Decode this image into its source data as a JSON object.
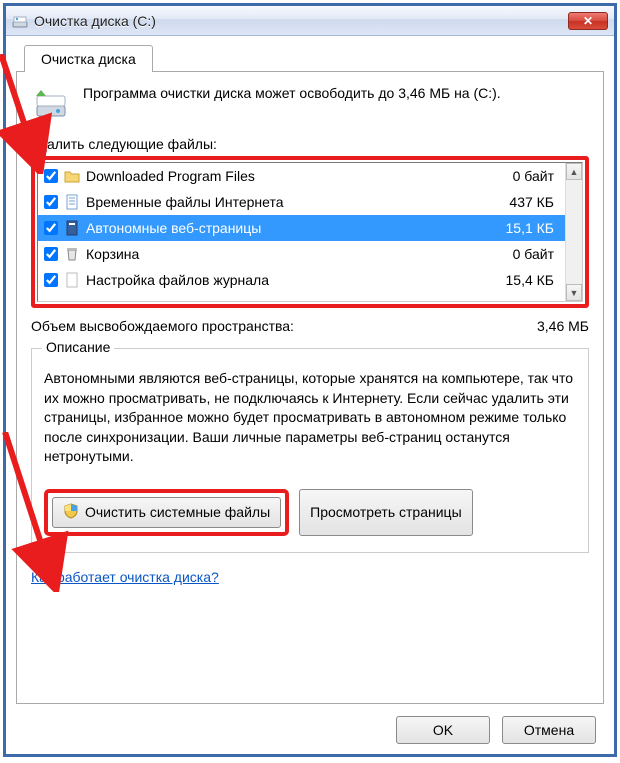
{
  "window": {
    "title": "Очистка диска  (C:)",
    "close_glyph": "✕"
  },
  "tab": {
    "label": "Очистка диска"
  },
  "info": {
    "text": "Программа очистки диска может освободить до 3,46 МБ на  (C:)."
  },
  "labels": {
    "delete_files": "Удалить следующие файлы:",
    "total_space": "Объем высвобождаемого пространства:",
    "description_group": "Описание"
  },
  "files": [
    {
      "name": "Downloaded Program Files",
      "size": "0 байт",
      "checked": true,
      "icon": "folder",
      "selected": false
    },
    {
      "name": "Временные файлы Интернета",
      "size": "437 КБ",
      "checked": true,
      "icon": "page",
      "selected": false
    },
    {
      "name": "Автономные веб-страницы",
      "size": "15,1 КБ",
      "checked": true,
      "icon": "page-dark",
      "selected": true
    },
    {
      "name": "Корзина",
      "size": "0 байт",
      "checked": true,
      "icon": "bin",
      "selected": false
    },
    {
      "name": "Настройка файлов журнала",
      "size": "15,4 КБ",
      "checked": true,
      "icon": "page-blank",
      "selected": false
    }
  ],
  "total_value": "3,46 МБ",
  "description": "Автономными являются веб-страницы, которые хранятся на компьютере, так что их можно просматривать, не подключаясь к Интернету. Если сейчас удалить эти страницы, избранное можно будет просматривать в автономном режиме только после синхронизации. Ваши личные параметры веб-страниц останутся нетронутыми.",
  "buttons": {
    "clean_system": "Очистить системные файлы",
    "view_page": "Просмотреть страницы",
    "ok": "OK",
    "cancel": "Отмена"
  },
  "link": {
    "help": "Как работает очистка диска?"
  },
  "colors": {
    "highlight": "#e91d1d",
    "selection": "#3399ff"
  }
}
